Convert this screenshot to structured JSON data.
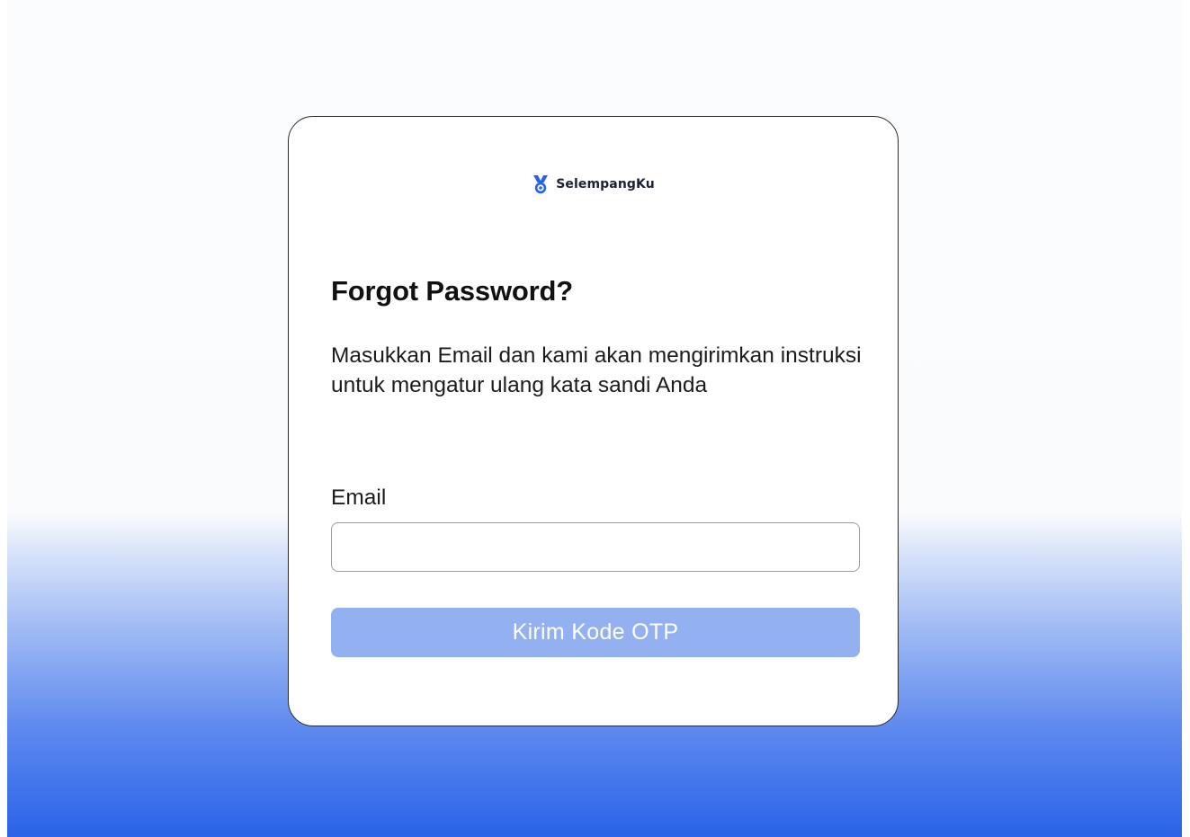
{
  "brand": {
    "name": "SelempangKu",
    "icon": "medal-icon",
    "accent_color": "#2563eb"
  },
  "form": {
    "title": "Forgot Password?",
    "description": "Masukkan Email dan kami akan mengirimkan instruksi untuk mengatur ulang kata sandi Anda",
    "email_label": "Email",
    "email_value": "",
    "email_placeholder": "",
    "submit_label": "Kirim Kode OTP",
    "submit_color": "#93b1f1"
  },
  "theme": {
    "background_bottom": "#2a63e8",
    "background_top": "#fafbfd"
  }
}
